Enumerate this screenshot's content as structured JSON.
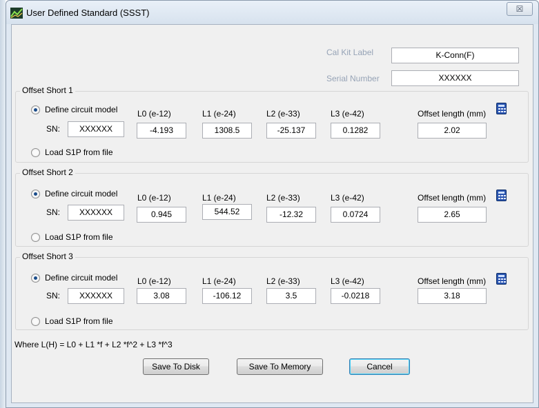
{
  "window": {
    "title": "User Defined Standard (SSST)",
    "close_glyph": "☒"
  },
  "header": {
    "cal_kit_label": "Cal Kit Label",
    "cal_kit_value": "K-Conn(F)",
    "serial_label": "Serial Number",
    "serial_value": "XXXXXX"
  },
  "labels": {
    "define": "Define circuit model",
    "sn": "SN:",
    "load": "Load S1P from file",
    "l0": "L0 (e-12)",
    "l1": "L1 (e-24)",
    "l2": "L2 (e-33)",
    "l3": "L3 (e-42)",
    "offset": "Offset length (mm)"
  },
  "groups": [
    {
      "title": "Offset Short 1",
      "sn": "XXXXXX",
      "l0": "-4.193",
      "l1": "1308.5",
      "l2": "-25.137",
      "l3": "0.1282",
      "offset": "2.02"
    },
    {
      "title": "Offset Short 2",
      "sn": "XXXXXX",
      "l0": "0.945",
      "l1": "544.52",
      "l2": "-12.32",
      "l3": "0.0724",
      "offset": "2.65"
    },
    {
      "title": "Offset Short 3",
      "sn": "XXXXXX",
      "l0": "3.08",
      "l1": "-106.12",
      "l2": "3.5",
      "l3": "-0.0218",
      "offset": "3.18"
    }
  ],
  "formula": "Where L(H) = L0 + L1 *f + L2 *f^2 + L3 *f^3",
  "buttons": {
    "save_disk": "Save To Disk",
    "save_memory": "Save To Memory",
    "cancel": "Cancel"
  },
  "icons": {
    "window": "app-icon",
    "calculator": "calculator-icon",
    "radio_selected": "radio-selected-icon",
    "radio_unselected": "radio-unselected-icon"
  }
}
